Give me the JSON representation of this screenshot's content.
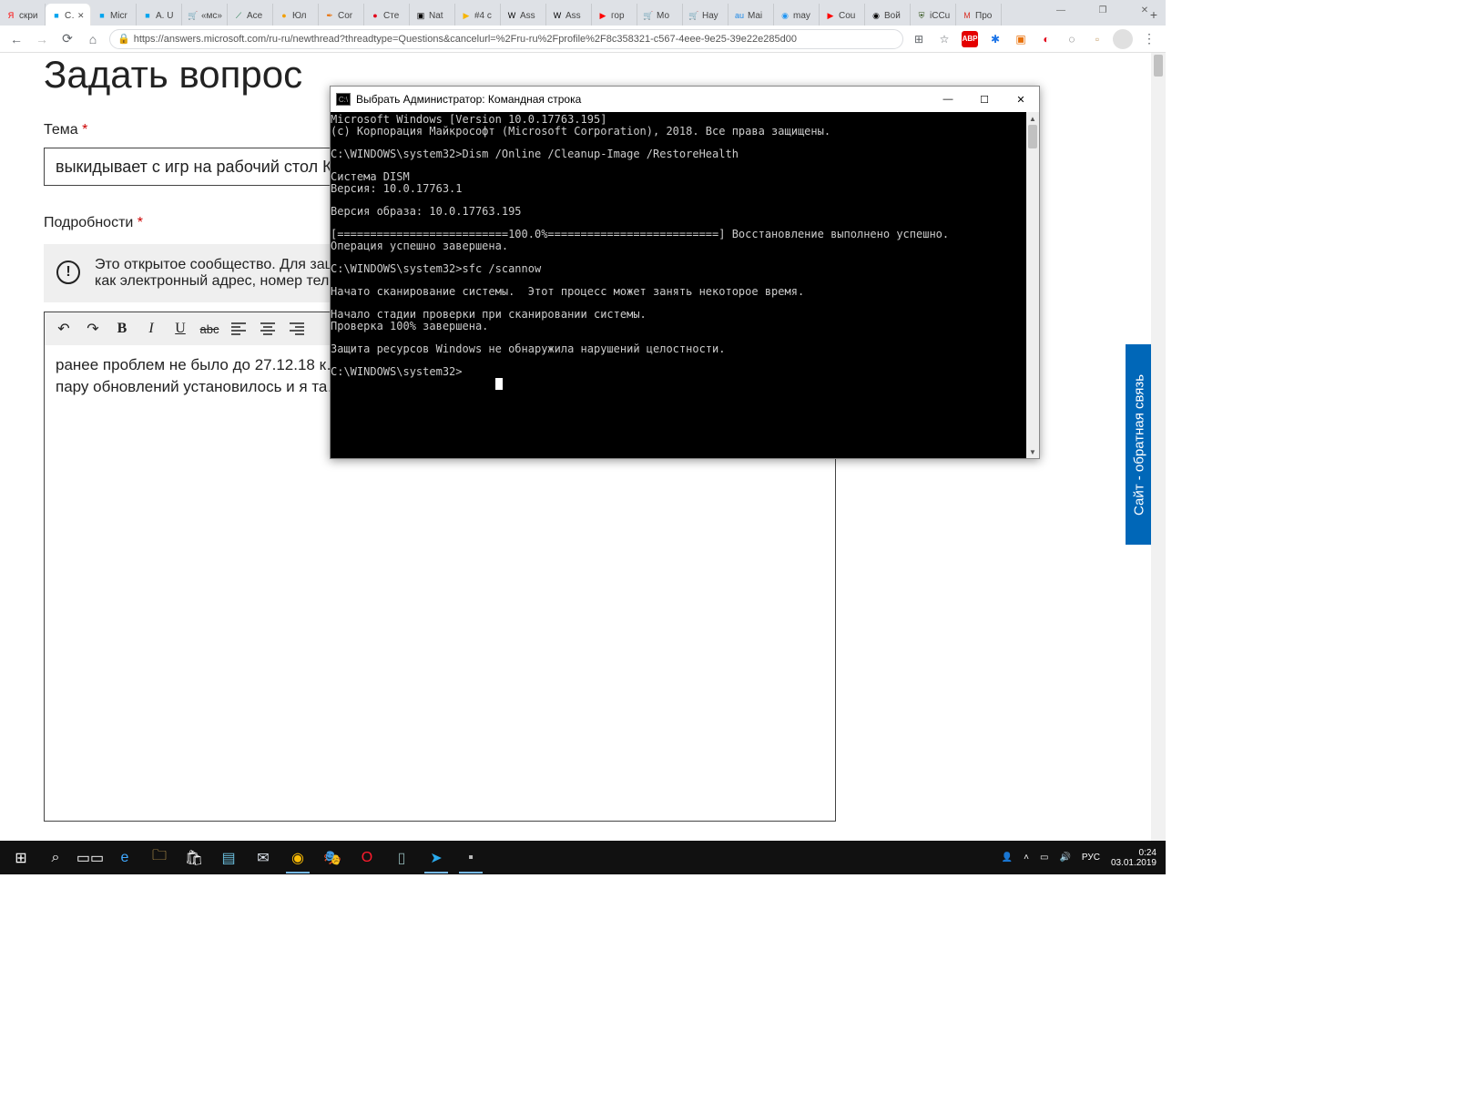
{
  "window": {
    "minimize": "—",
    "maximize": "❐",
    "close": "✕"
  },
  "tabs": [
    {
      "label": "скри",
      "fav": "Я",
      "favcolor": "#ff0000"
    },
    {
      "label": "С…",
      "fav": "■",
      "favcolor": "#00a4ef",
      "active": true
    },
    {
      "label": "Micr",
      "fav": "■",
      "favcolor": "#00a4ef"
    },
    {
      "label": "A. U",
      "fav": "■",
      "favcolor": "#00a4ef"
    },
    {
      "label": "«мс»",
      "fav": "🛒",
      "favcolor": "#ff8c00"
    },
    {
      "label": "Ace",
      "fav": "⟋",
      "favcolor": "#177245"
    },
    {
      "label": "Юл",
      "fav": "●",
      "favcolor": "#f29f05"
    },
    {
      "label": "Cor",
      "fav": "✒",
      "favcolor": "#e8710a"
    },
    {
      "label": "Сте",
      "fav": "●",
      "favcolor": "#e2001a"
    },
    {
      "label": "Nat",
      "fav": "▣",
      "favcolor": "#000"
    },
    {
      "label": "#4 c",
      "fav": "▶",
      "favcolor": "#f7b500"
    },
    {
      "label": "Ass",
      "fav": "W",
      "favcolor": "#000"
    },
    {
      "label": "Ass",
      "fav": "W",
      "favcolor": "#000"
    },
    {
      "label": "гор",
      "fav": "▶",
      "favcolor": "#ff0000"
    },
    {
      "label": "Мо",
      "fav": "🛒",
      "favcolor": "#ff8c00"
    },
    {
      "label": "Нау",
      "fav": "🛒",
      "favcolor": "#ff8c00"
    },
    {
      "label": "Mai",
      "fav": "au",
      "favcolor": "#1e88e5"
    },
    {
      "label": "may",
      "fav": "◉",
      "favcolor": "#2196f3"
    },
    {
      "label": "Cou",
      "fav": "▶",
      "favcolor": "#ff0000"
    },
    {
      "label": "Вой",
      "fav": "◉",
      "favcolor": "#000"
    },
    {
      "label": "iCCu",
      "fav": "⛨",
      "favcolor": "#2d5016"
    },
    {
      "label": "Про",
      "fav": "M",
      "favcolor": "#d93025"
    }
  ],
  "toolbar": {
    "url": "https://answers.microsoft.com/ru-ru/newthread?threadtype=Questions&cancelurl=%2Fru-ru%2Fprofile%2F8c358321-c567-4eee-9e25-39e22e285d00",
    "secure": "🔒"
  },
  "extensions": [
    {
      "name": "zoom-icon",
      "glyph": "⊞",
      "color": "#5f6368"
    },
    {
      "name": "star-icon",
      "glyph": "☆",
      "color": "#5f6368"
    },
    {
      "name": "abp-icon",
      "glyph": "ABP",
      "color": "#fff",
      "bg": "#e40000"
    },
    {
      "name": "ext2-icon",
      "glyph": "✱",
      "color": "#1a73e8"
    },
    {
      "name": "ext3-icon",
      "glyph": "▣",
      "color": "#e8710a"
    },
    {
      "name": "ublock-icon",
      "glyph": "◐",
      "color": "#e2001a"
    },
    {
      "name": "ext5-icon",
      "glyph": "◌",
      "color": "#333"
    },
    {
      "name": "ext6-icon",
      "glyph": "▫",
      "color": "#c49b66"
    }
  ],
  "page": {
    "title": "Задать вопрос",
    "theme_label": "Тема",
    "req": "*",
    "topic_value": "выкидывает с игр на рабочий стол К…",
    "details_label": "Подробности",
    "notice": "Это открытое сообщество. Для защ…\nкак электронный адрес, номер тел…",
    "editor_text": "ранее проблем не было до 27.12.18 к…\nпару обновлений установилось и я та…",
    "feedback": "Сайт - обратная связь"
  },
  "cmd": {
    "title": "Выбрать Администратор: Командная строка",
    "icon_label": "C:\\",
    "body": "Microsoft Windows [Version 10.0.17763.195]\n(c) Корпорация Майкрософт (Microsoft Corporation), 2018. Все права защищены.\n\nC:\\WINDOWS\\system32>Dism /Online /Cleanup-Image /RestoreHealth\n\nCистема DISM\nВерсия: 10.0.17763.1\n\nВерсия образа: 10.0.17763.195\n\n[==========================100.0%==========================] Восстановление выполнено успешно.\nОперация успешно завершена.\n\nC:\\WINDOWS\\system32>sfc /scannow\n\nНачато сканирование системы.  Этот процесс может занять некоторое время.\n\nНачало стадии проверки при сканировании системы.\nПроверка 100% завершена.\n\nЗащита ресурсов Windows не обнаружила нарушений целостности.\n\nC:\\WINDOWS\\system32>",
    "minimize": "—",
    "maximize": "☐",
    "close": "✕"
  },
  "taskbar": {
    "items": [
      {
        "name": "start",
        "glyph": "⊞",
        "color": "#fff"
      },
      {
        "name": "search",
        "glyph": "⌕",
        "color": "#fff"
      },
      {
        "name": "taskview",
        "glyph": "▭▭",
        "color": "#fff"
      },
      {
        "name": "edge",
        "glyph": "e",
        "color": "#40a9ff"
      },
      {
        "name": "explorer",
        "glyph": "🗀",
        "color": "#ffcc66"
      },
      {
        "name": "store",
        "glyph": "🛍",
        "color": "#fff"
      },
      {
        "name": "calc",
        "glyph": "▤",
        "color": "#6cc1e0"
      },
      {
        "name": "mail",
        "glyph": "✉",
        "color": "#dfe6ee"
      },
      {
        "name": "chrome",
        "glyph": "◉",
        "color": "#fbbc05",
        "active": true
      },
      {
        "name": "obs",
        "glyph": "🎭",
        "color": "#a0866d"
      },
      {
        "name": "opera",
        "glyph": "O",
        "color": "#ff1b2d"
      },
      {
        "name": "app1",
        "glyph": "▯",
        "color": "#8aa"
      },
      {
        "name": "telegram",
        "glyph": "➤",
        "color": "#2aabee",
        "active": true
      },
      {
        "name": "cmd",
        "glyph": "▪",
        "color": "#bbb",
        "active": true
      }
    ],
    "tray": {
      "people": "👤",
      "up": "˄",
      "net": "▭",
      "vol": "🔊",
      "lang": "РУС",
      "time": "0:24",
      "date": "03.01.2019"
    }
  }
}
